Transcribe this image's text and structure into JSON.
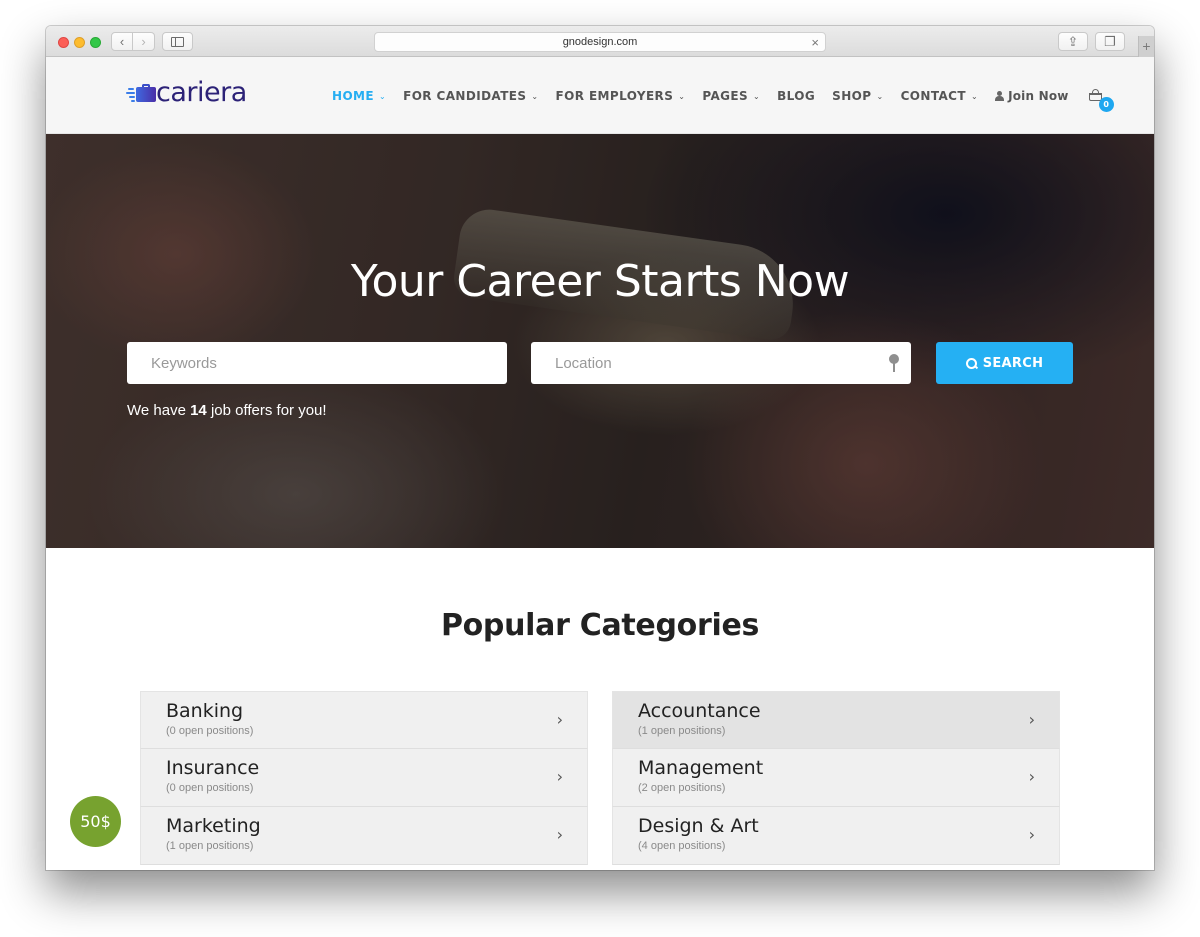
{
  "browser": {
    "url": "gnodesign.com",
    "back_icon": "chevron-left",
    "forward_icon": "chevron-right",
    "clear_icon": "×",
    "new_tab_icon": "+"
  },
  "header": {
    "logo_text": "cariera",
    "nav": [
      {
        "label": "HOME",
        "has_dropdown": true,
        "active": true
      },
      {
        "label": "FOR CANDIDATES",
        "has_dropdown": true
      },
      {
        "label": "FOR EMPLOYERS",
        "has_dropdown": true
      },
      {
        "label": "PAGES",
        "has_dropdown": true
      },
      {
        "label": "BLOG",
        "has_dropdown": false
      },
      {
        "label": "SHOP",
        "has_dropdown": true
      },
      {
        "label": "CONTACT",
        "has_dropdown": true
      }
    ],
    "chevron": "⌄",
    "join_label": "Join Now",
    "cart_count": "0"
  },
  "hero": {
    "title": "Your Career Starts Now",
    "keywords_placeholder": "Keywords",
    "location_placeholder": "Location",
    "search_label": "SEARCH",
    "offers_prefix": "We have ",
    "offers_count": "14",
    "offers_suffix": " job offers for you!"
  },
  "categories": {
    "title": "Popular Categories",
    "arrow": "›",
    "left": [
      {
        "name": "Banking",
        "count": "(0 open positions)"
      },
      {
        "name": "Insurance",
        "count": "(0 open positions)"
      },
      {
        "name": "Marketing",
        "count": "(1 open positions)"
      }
    ],
    "right": [
      {
        "name": "Accountance",
        "count": "(1 open positions)"
      },
      {
        "name": "Management",
        "count": "(2 open positions)"
      },
      {
        "name": "Design & Art",
        "count": "(4 open positions)"
      }
    ]
  },
  "price_badge": "50$",
  "colors": {
    "accent": "#26aef2",
    "logo": "#2c2277",
    "price_badge": "#77a22f"
  }
}
